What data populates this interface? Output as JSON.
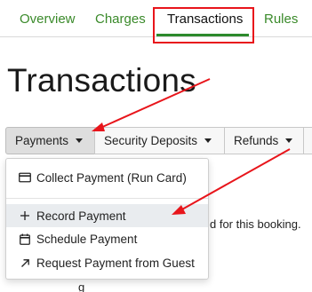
{
  "tabs": {
    "items": [
      {
        "label": "Overview"
      },
      {
        "label": "Charges"
      },
      {
        "label": "Transactions"
      },
      {
        "label": "Rules"
      }
    ],
    "active_color": "#2c8a2c",
    "link_color": "#3a8a2a"
  },
  "page": {
    "title": "Transactions"
  },
  "toolbar": {
    "payments_label": "Payments",
    "deposits_label": "Security Deposits",
    "refunds_label": "Refunds"
  },
  "dropdown": {
    "items": [
      {
        "label": "Collect Payment (Run Card)",
        "icon": "credit-card-icon"
      },
      {
        "label": "Record Payment",
        "icon": "plus-icon"
      },
      {
        "label": "Schedule Payment",
        "icon": "calendar-icon"
      },
      {
        "label": "Request Payment from Guest",
        "icon": "arrow-up-right-icon"
      }
    ]
  },
  "background": {
    "partial_text": "d for this booking.",
    "partial_text_2": "g"
  },
  "annotation": {
    "color": "#e8151b"
  }
}
